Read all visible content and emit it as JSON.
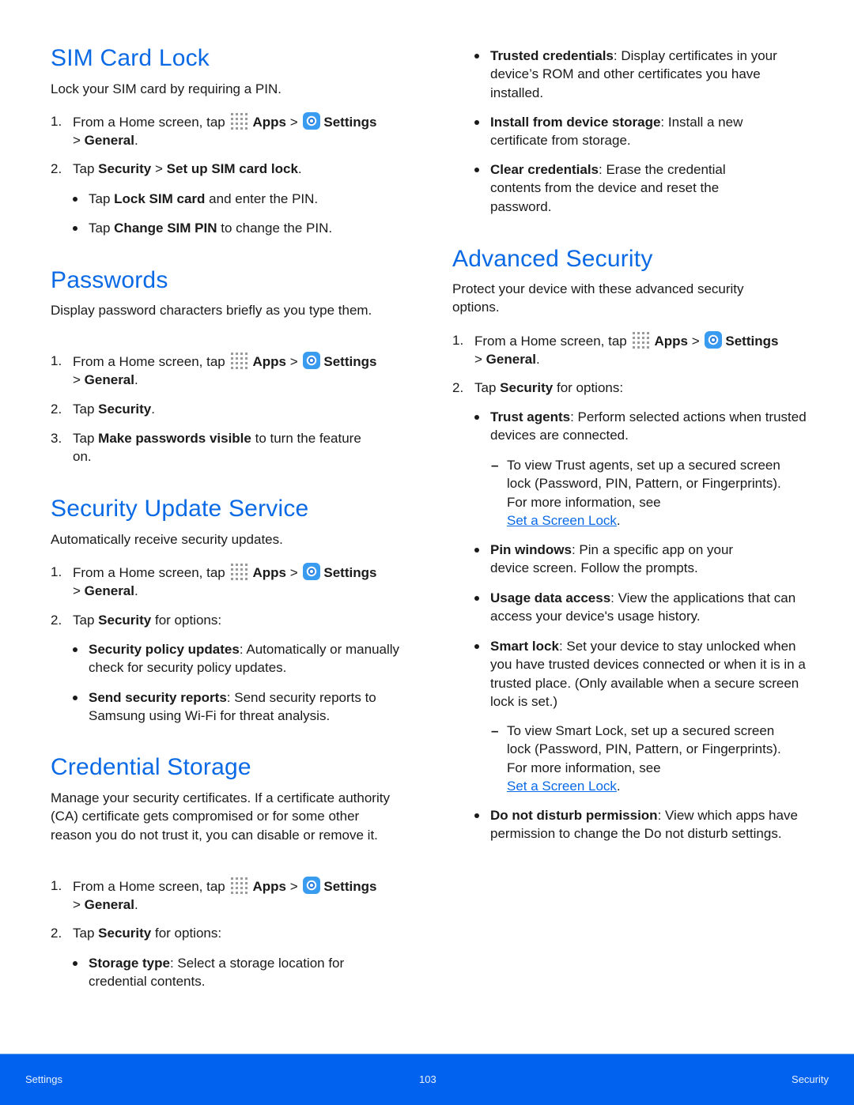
{
  "colors": {
    "heading": "#0a6ae6",
    "footer_bg": "#0062ee",
    "link": "#0a6ae6"
  },
  "common": {
    "step_from_home_prefix": "From a Home screen, tap",
    "apps_label": "Apps",
    "gt": ">",
    "settings_label": "Settings",
    "general_label": "General",
    "period": ".",
    "tap": "Tap",
    "security_label": "Security",
    "for_options": "for options:",
    "apps_icon": "apps-grid-icon",
    "settings_icon": "settings-gear-icon"
  },
  "sim_card_lock": {
    "title": "SIM Card Lock",
    "intro": "Lock your SIM card by requiring a PIN.",
    "step2_bold2": "Set up SIM card lock",
    "bullets": [
      {
        "bold": "Lock SIM card",
        "text": "and enter the PIN."
      },
      {
        "bold": "Change SIM PIN",
        "text": "to change the PIN."
      }
    ]
  },
  "passwords": {
    "title": "Passwords",
    "intro": "Display password characters briefly as you type them.",
    "step3_bold": "Make passwords visible",
    "step3_text": "to turn the feature on."
  },
  "security_update_service": {
    "title": "Security Update Service",
    "intro": "Automatically receive security updates.",
    "bullets": [
      {
        "bold": "Security policy updates",
        "text": ": Automatically or manually check for security policy updates."
      },
      {
        "bold": "Send security reports",
        "text": ": Send security reports to Samsung using Wi-Fi for threat analysis."
      }
    ]
  },
  "credential_storage": {
    "title": "Credential Storage",
    "intro": "Manage your security certificates. If a certificate authority (CA) certificate gets compromised or for some other reason you do not trust it, you can disable or remove it.",
    "bullets": [
      {
        "bold": "Storage type",
        "text": ": Select a storage location for credential contents."
      },
      {
        "bold": "Trusted credentials",
        "text": ": Display certificates in your device’s ROM and other certificates you have installed."
      },
      {
        "bold": "Install from device storage",
        "text": ": Install a new certificate from storage."
      },
      {
        "bold": "Clear credentials",
        "text": ": Erase the credential contents from the device and reset the password."
      }
    ]
  },
  "advanced_security": {
    "title": "Advanced Security",
    "intro": "Protect your device with these advanced security options.",
    "bullets": [
      {
        "bold": "Trust agents",
        "text": ": Perform selected actions when trusted devices are connected."
      },
      {
        "bold": "Pin windows",
        "text": ": Pin a specific app on your device screen. Follow the prompts."
      },
      {
        "bold": "Usage data access",
        "text": ": View the applications that can access your device's usage history."
      },
      {
        "bold": "Smart lock",
        "text": ": Set your device to stay unlocked when you have trusted devices connected or when it is in a trusted place. (Only available when a secure screen lock is set.)"
      },
      {
        "bold": "Do not disturb permission",
        "text": ": View which apps have permission to change the Do not disturb settings."
      }
    ],
    "sub_trust": "To view Trust agents, set up a secured screen lock (Password, PIN, Pattern, or Fingerprints). For more information, see",
    "sub_smart": "To view Smart Lock, set up a secured screen lock (Password, PIN, Pattern, or Fingerprints). For more information, see",
    "link_label": "Set a Screen Lock"
  },
  "footer": {
    "left": "Settings",
    "page": "103",
    "right": "Security"
  }
}
